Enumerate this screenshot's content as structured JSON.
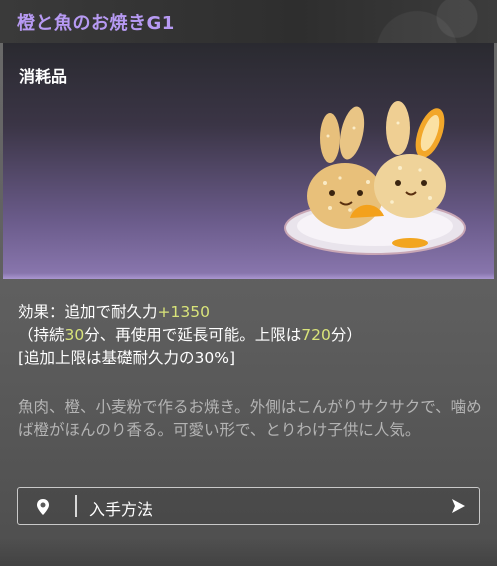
{
  "item": {
    "title": "橙と魚のお焼きG1",
    "category": "消耗品",
    "effect_line1_prefix": "効果：追加で耐久力",
    "effect_line1_value": "+1350",
    "effect_line2_a": "（持続",
    "effect_line2_v1": "30",
    "effect_line2_b": "分、再使用で延長可能。上限は",
    "effect_line2_v2": "720",
    "effect_line2_c": "分）",
    "effect_line3": "[追加上限は基礎耐久力の30%]",
    "description": "魚肉、橙、小麦粉で作るお焼き。外側はこんがりサクサクで、噛めば橙がほんのり香る。可愛い形で、とりわけ子供に人気。",
    "image_icon": "bunny-shaped-fish-cakes-on-plate"
  },
  "acquire_button": {
    "label": "入手方法",
    "left_icon": "location-pin-icon",
    "right_icon": "play-arrow-icon"
  },
  "colors": {
    "title": "#b79af3",
    "highlight": "#d9e47a",
    "description": "#b4b4b4"
  }
}
